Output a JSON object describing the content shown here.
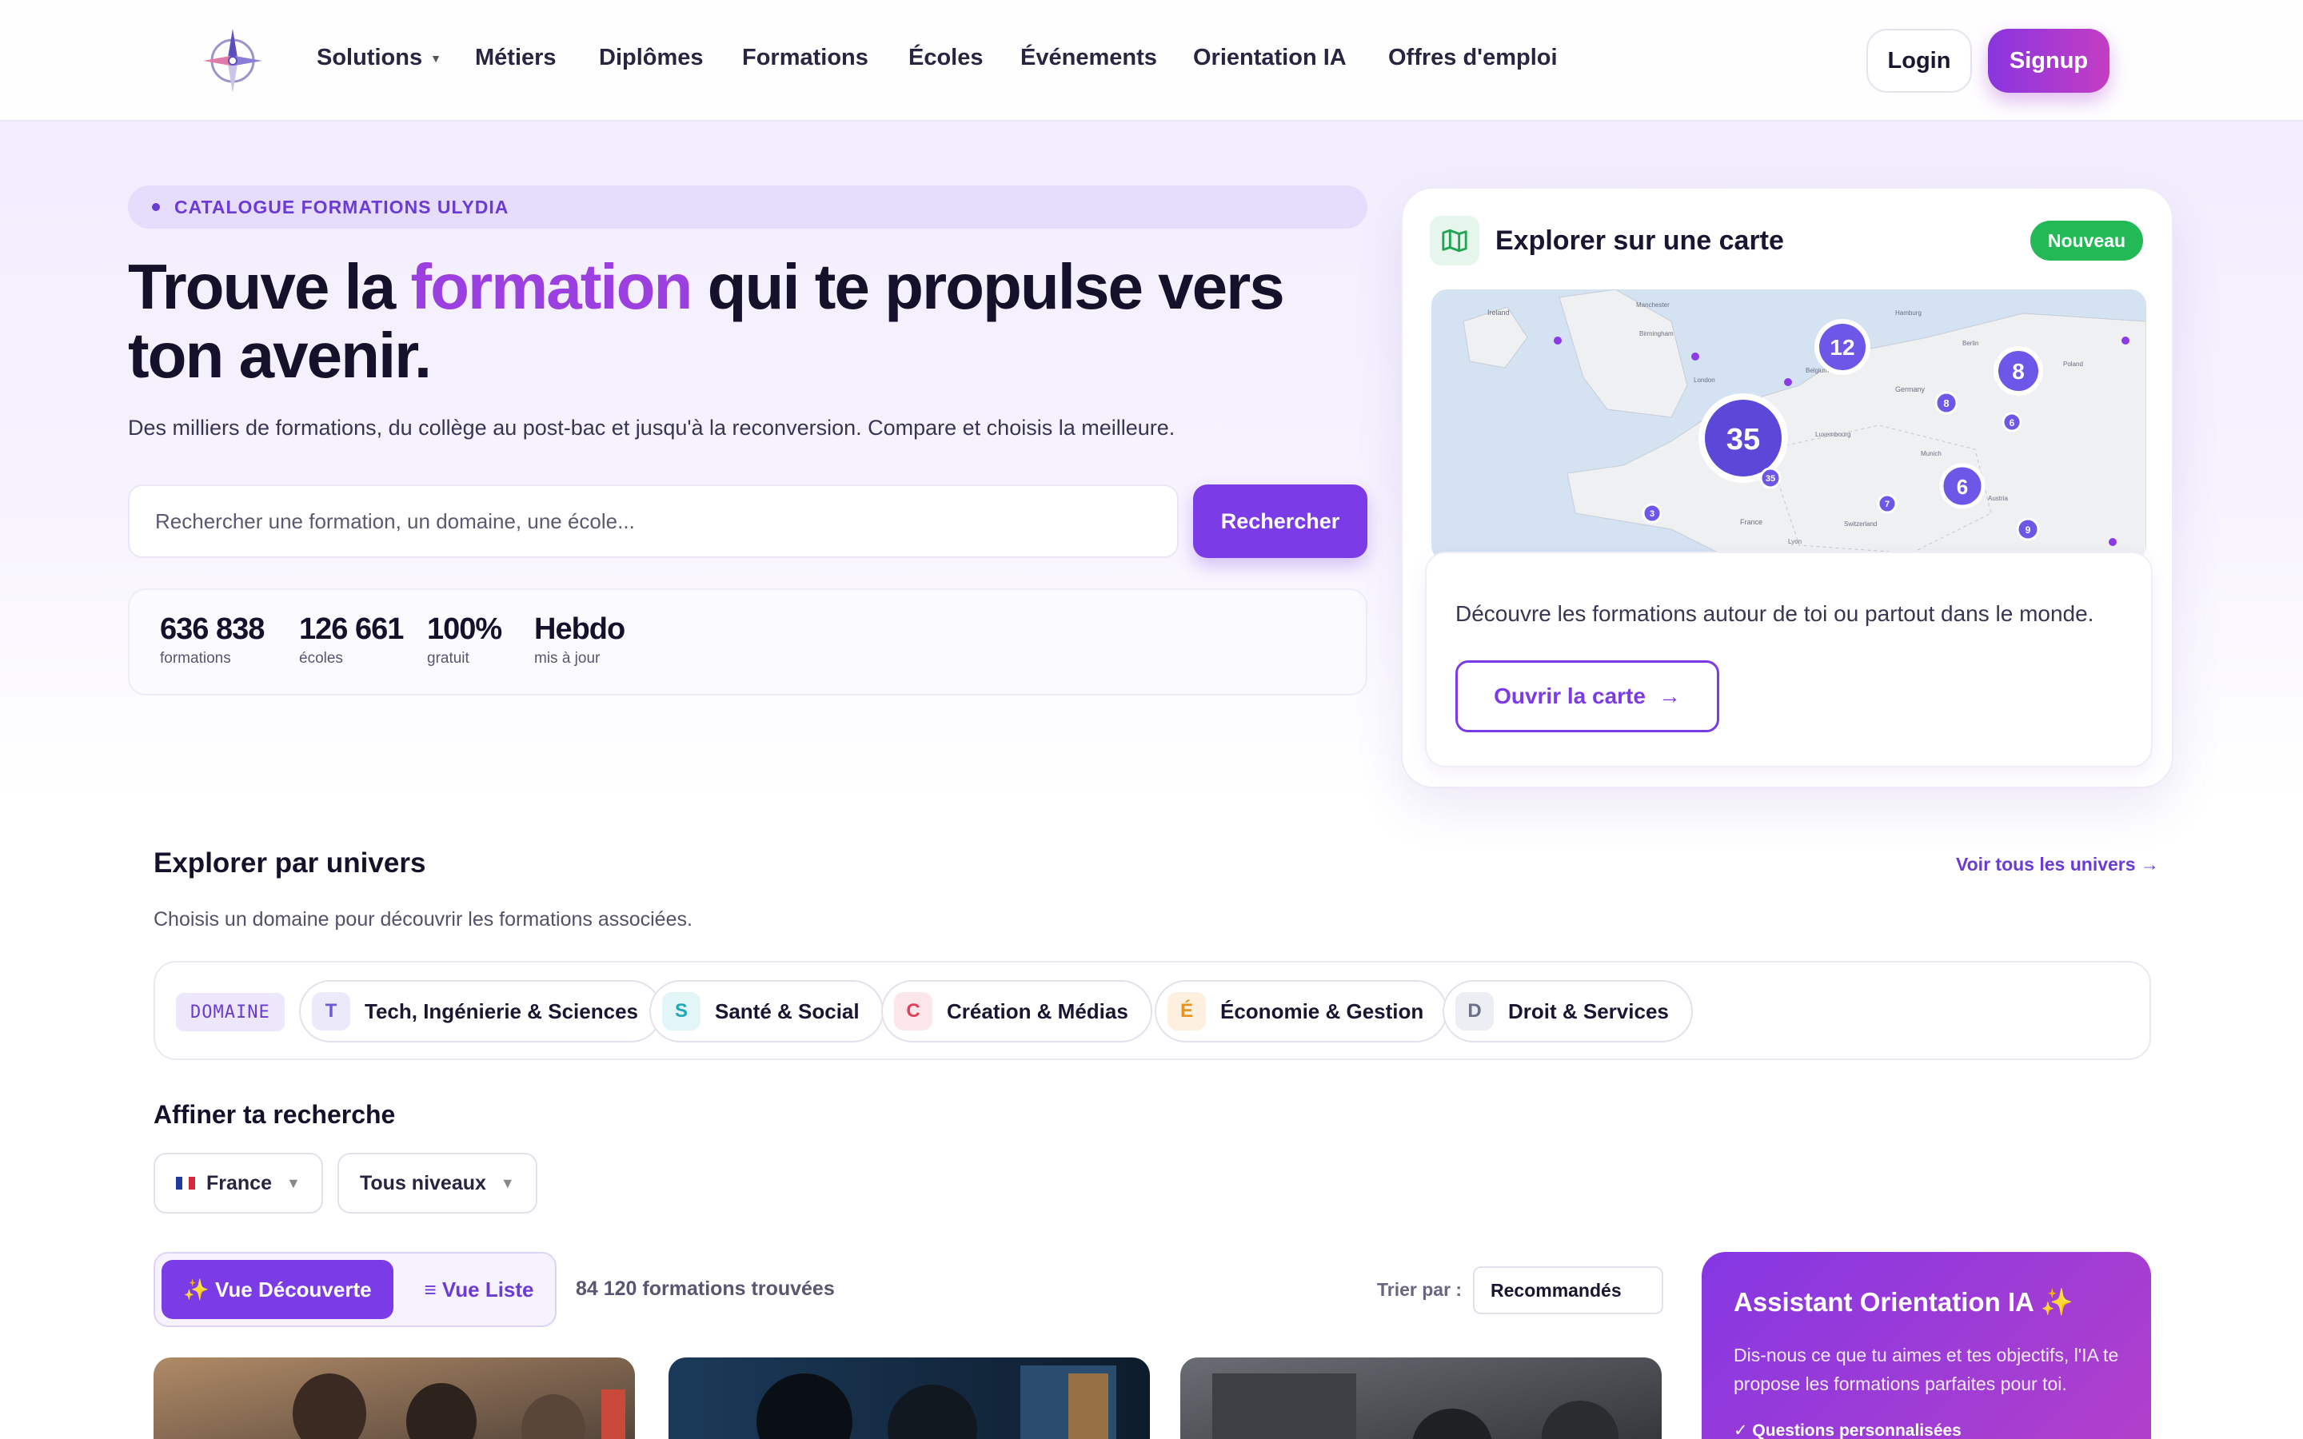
{
  "nav": {
    "items": [
      "Solutions",
      "Métiers",
      "Diplômes",
      "Formations",
      "Écoles",
      "Événements",
      "Orientation IA",
      "Offres d'emploi"
    ],
    "login": "Login",
    "signup": "Signup"
  },
  "hero": {
    "pill": "CATALOGUE FORMATIONS ULYDIA",
    "title_pre": "Trouve la ",
    "title_accent": "formation",
    "title_post": " qui te propulse vers ton avenir.",
    "subtitle": "Des milliers de formations, du collège au post-bac et jusqu'à la reconversion. Compare et choisis la meilleure.",
    "search_placeholder": "Rechercher une formation, un domaine, une école...",
    "search_button": "Rechercher",
    "stats": [
      {
        "value": "636 838",
        "label": "formations"
      },
      {
        "value": "126 661",
        "label": "écoles"
      },
      {
        "value": "100%",
        "label": "gratuit"
      },
      {
        "value": "Hebdo",
        "label": "mis à jour"
      }
    ]
  },
  "map": {
    "title": "Explorer sur une carte",
    "badge": "Nouveau",
    "description": "Découvre les formations autour de toi ou partout dans le monde.",
    "button": "Ouvrir la carte",
    "clusters": [
      "12",
      "8",
      "35",
      "6",
      "8",
      "6",
      "35",
      "7",
      "9",
      "3"
    ],
    "place_labels": [
      "Ireland",
      "Manchester",
      "Birmingham",
      "London",
      "Hamburg",
      "Berlin",
      "Poland",
      "Germany",
      "Belgium",
      "Luxembourg",
      "Munich",
      "France",
      "Switzerland",
      "Austria",
      "Lyon"
    ]
  },
  "univers": {
    "title": "Explorer par univers",
    "subtitle": "Choisis un domaine pour découvrir les formations associées.",
    "see_all": "Voir tous les univers →",
    "domain_label": "DOMAINE",
    "domains": [
      {
        "letter": "T",
        "label": "Tech, Ingénierie & Sciences",
        "bg": "#ece9fb",
        "fg": "#6b5bd6"
      },
      {
        "letter": "S",
        "label": "Santé & Social",
        "bg": "#e2f6f8",
        "fg": "#1fa7b8"
      },
      {
        "letter": "C",
        "label": "Création & Médias",
        "bg": "#fde6ea",
        "fg": "#e0405a"
      },
      {
        "letter": "É",
        "label": "Économie & Gestion",
        "bg": "#fdf0de",
        "fg": "#e89321"
      },
      {
        "letter": "D",
        "label": "Droit & Services",
        "bg": "#eceef3",
        "fg": "#6a7186"
      }
    ]
  },
  "filters": {
    "title": "Affiner ta recherche",
    "country": "France",
    "level": "Tous niveaux",
    "view_discover": "✨ Vue Découverte",
    "view_list": "≡ Vue Liste",
    "result_count": "84 120 formations trouvées",
    "sort_label": "Trier par :",
    "sort_value": "Recommandés"
  },
  "assistant": {
    "title": "Assistant Orientation IA ✨",
    "description": "Dis-nous ce que tu aimes et tes objectifs, l'IA te propose les formations parfaites pour toi.",
    "feature": "✓ Questions personnalisées"
  },
  "colors": {
    "accent": "#7b3be6",
    "accent_text": "#9c3fe0",
    "success": "#23b957"
  }
}
